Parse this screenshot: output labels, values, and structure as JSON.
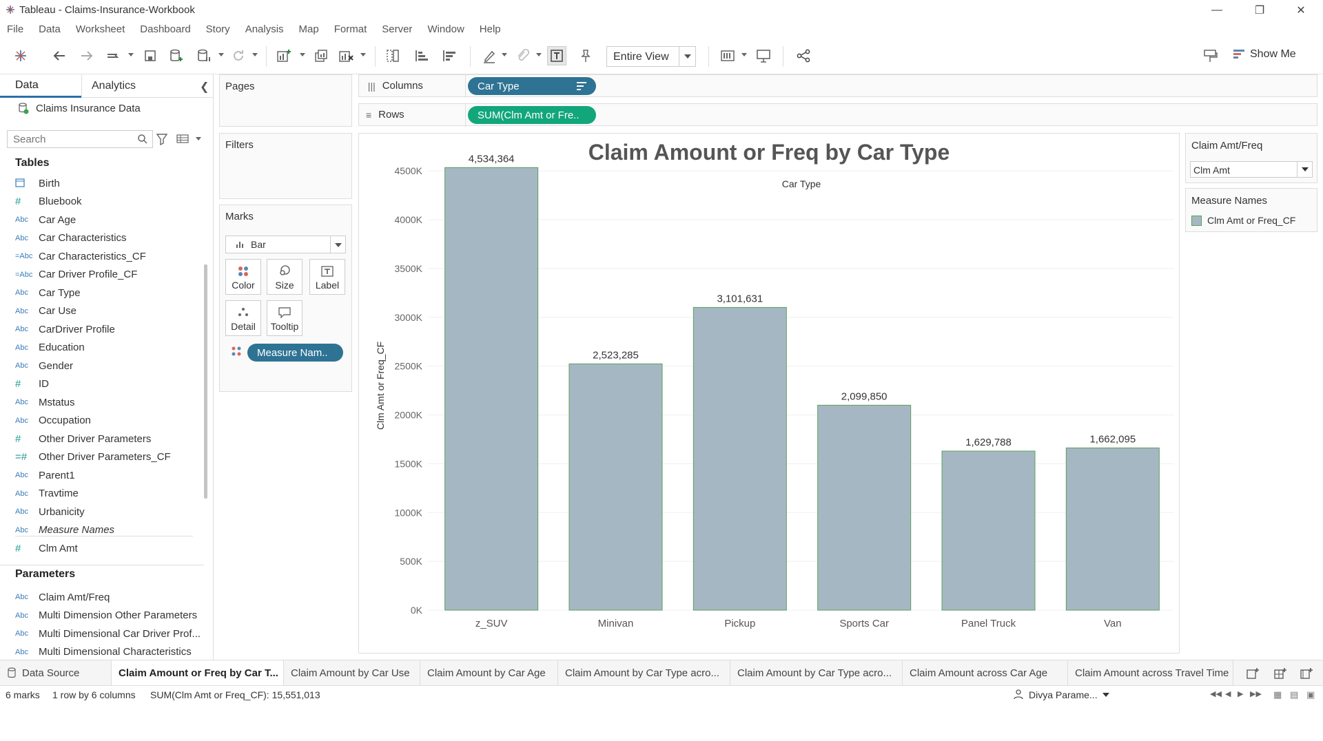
{
  "window": {
    "title": "Tableau - Claims-Insurance-Workbook"
  },
  "menu": [
    "File",
    "Data",
    "Worksheet",
    "Dashboard",
    "Story",
    "Analysis",
    "Map",
    "Format",
    "Server",
    "Window",
    "Help"
  ],
  "toolbar": {
    "fit_value": "Entire View",
    "show_me_label": "Show Me"
  },
  "data_pane": {
    "tab_data": "Data",
    "tab_analytics": "Analytics",
    "datasource": "Claims Insurance Data",
    "search_placeholder": "Search",
    "tables_title": "Tables",
    "fields": [
      {
        "icon": "date",
        "name": "Birth"
      },
      {
        "icon": "#",
        "name": "Bluebook"
      },
      {
        "icon": "Abc",
        "name": "Car Age"
      },
      {
        "icon": "Abc",
        "name": "Car Characteristics"
      },
      {
        "icon": "=Abc",
        "name": "Car Characteristics_CF"
      },
      {
        "icon": "=Abc",
        "name": "Car Driver Profile_CF"
      },
      {
        "icon": "Abc",
        "name": "Car Type"
      },
      {
        "icon": "Abc",
        "name": "Car Use"
      },
      {
        "icon": "Abc",
        "name": "CarDriver Profile"
      },
      {
        "icon": "Abc",
        "name": "Education"
      },
      {
        "icon": "Abc",
        "name": "Gender"
      },
      {
        "icon": "#",
        "name": "ID"
      },
      {
        "icon": "Abc",
        "name": "Mstatus"
      },
      {
        "icon": "Abc",
        "name": "Occupation"
      },
      {
        "icon": "#",
        "name": "Other Driver Parameters"
      },
      {
        "icon": "=#",
        "name": "Other Driver Parameters_CF"
      },
      {
        "icon": "Abc",
        "name": "Parent1"
      },
      {
        "icon": "Abc",
        "name": "Travtime"
      },
      {
        "icon": "Abc",
        "name": "Urbanicity"
      },
      {
        "icon": "Abc",
        "name": "Measure Names"
      },
      {
        "icon": "#",
        "name": "Clm Amt"
      }
    ],
    "parameters_title": "Parameters",
    "parameters": [
      {
        "icon": "Abc",
        "name": "Claim Amt/Freq"
      },
      {
        "icon": "Abc",
        "name": "Multi Dimension Other Parameters"
      },
      {
        "icon": "Abc",
        "name": "Multi Dimensional Car Driver Prof..."
      },
      {
        "icon": "Abc",
        "name": "Multi Dimensional Characteristics"
      }
    ]
  },
  "cards": {
    "pages": "Pages",
    "filters": "Filters",
    "marks": "Marks",
    "mark_type": "Bar",
    "mark_buttons": [
      "Color",
      "Size",
      "Label",
      "Detail",
      "Tooltip"
    ],
    "marks_pill": "Measure Nam.."
  },
  "shelves": {
    "columns_label": "Columns",
    "rows_label": "Rows",
    "columns_pill": "Car Type",
    "rows_pill": "SUM(Clm Amt or Fre.."
  },
  "right_cards": {
    "param_title": "Claim Amt/Freq",
    "param_value": "Clm Amt",
    "legend_title": "Measure Names",
    "legend_item": "Clm Amt or Freq_CF"
  },
  "chart_data": {
    "type": "bar",
    "title": "Claim Amount or Freq by Car Type",
    "xlabel": "Car Type",
    "ylabel": "Clm Amt or Freq_CF",
    "categories": [
      "z_SUV",
      "Minivan",
      "Pickup",
      "Sports Car",
      "Panel Truck",
      "Van"
    ],
    "values": [
      4534364,
      2523285,
      3101631,
      2099850,
      1629788,
      1662095
    ],
    "value_labels": [
      "4,534,364",
      "2,523,285",
      "3,101,631",
      "2,099,850",
      "1,629,788",
      "1,662,095"
    ],
    "ylim": [
      0,
      4600000
    ],
    "yticks": [
      0,
      500000,
      1000000,
      1500000,
      2000000,
      2500000,
      3000000,
      3500000,
      4000000,
      4500000
    ],
    "ytick_labels": [
      "0K",
      "500K",
      "1000K",
      "1500K",
      "2000K",
      "2500K",
      "3000K",
      "3500K",
      "4000K",
      "4500K"
    ],
    "grid": true,
    "bar_color": "#a6b7c4",
    "bar_border_color": "#5aa05a"
  },
  "sheet_tabs": {
    "datasource": "Data Source",
    "tabs": [
      "Claim Amount or Freq by Car T...",
      "Claim Amount by Car Use",
      "Claim Amount by Car Age",
      "Claim Amount by Car Type acro...",
      "Claim Amount by Car Type acro...",
      "Claim Amount across Car Age",
      "Claim Amount across Travel Time"
    ]
  },
  "status": {
    "marks": "6 marks",
    "dims": "1 row by 6 columns",
    "sum": "SUM(Clm Amt or Freq_CF): 15,551,013",
    "user": "Divya Parame..."
  },
  "colors": {
    "accent": "#2e7394",
    "green_pill": "#12a67b",
    "tab_blue": "#2b6fa8"
  }
}
